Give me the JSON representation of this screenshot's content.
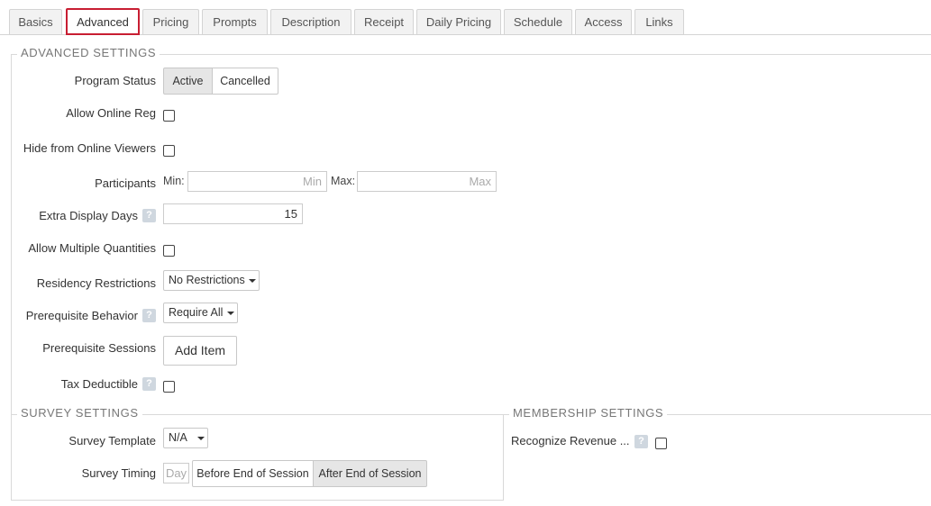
{
  "tabs": [
    {
      "label": "Basics"
    },
    {
      "label": "Advanced"
    },
    {
      "label": "Pricing"
    },
    {
      "label": "Prompts"
    },
    {
      "label": "Description"
    },
    {
      "label": "Receipt"
    },
    {
      "label": "Daily Pricing"
    },
    {
      "label": "Schedule"
    },
    {
      "label": "Access"
    },
    {
      "label": "Links"
    }
  ],
  "active_tab": "Advanced",
  "advanced": {
    "legend": "ADVANCED SETTINGS",
    "program_status": {
      "label": "Program Status",
      "options": [
        "Active",
        "Cancelled"
      ],
      "selected": "Active"
    },
    "allow_online_reg": {
      "label": "Allow Online Reg",
      "checked": false
    },
    "hide_online": {
      "label": "Hide from Online Viewers",
      "checked": false
    },
    "participants": {
      "label": "Participants",
      "min_label": "Min:",
      "min_placeholder": "Min",
      "max_label": "Max:",
      "max_placeholder": "Max"
    },
    "extra_display_days": {
      "label": "Extra Display Days",
      "help": "?",
      "value": "15"
    },
    "allow_multiple": {
      "label": "Allow Multiple Quantities",
      "checked": false
    },
    "residency": {
      "label": "Residency Restrictions",
      "selected": "No Restrictions"
    },
    "prereq_behavior": {
      "label": "Prerequisite Behavior",
      "help": "?",
      "selected": "Require All"
    },
    "prereq_sessions": {
      "label": "Prerequisite Sessions",
      "button": "Add Item"
    },
    "tax_deductible": {
      "label": "Tax Deductible",
      "help": "?",
      "checked": false
    }
  },
  "survey": {
    "legend": "SURVEY SETTINGS",
    "template": {
      "label": "Survey Template",
      "selected": "N/A"
    },
    "timing": {
      "label": "Survey Timing",
      "day_placeholder": "Day",
      "options": [
        "Before End of Session",
        "After End of Session"
      ],
      "selected": "After End of Session"
    }
  },
  "membership": {
    "legend": "MEMBERSHIP SETTINGS",
    "recognize_revenue": {
      "label": "Recognize Revenue ...",
      "help": "?",
      "checked": false
    }
  },
  "colors": {
    "accent": "#c81e32",
    "help_badge": "#cfd7df",
    "border": "#d9d9d9"
  }
}
